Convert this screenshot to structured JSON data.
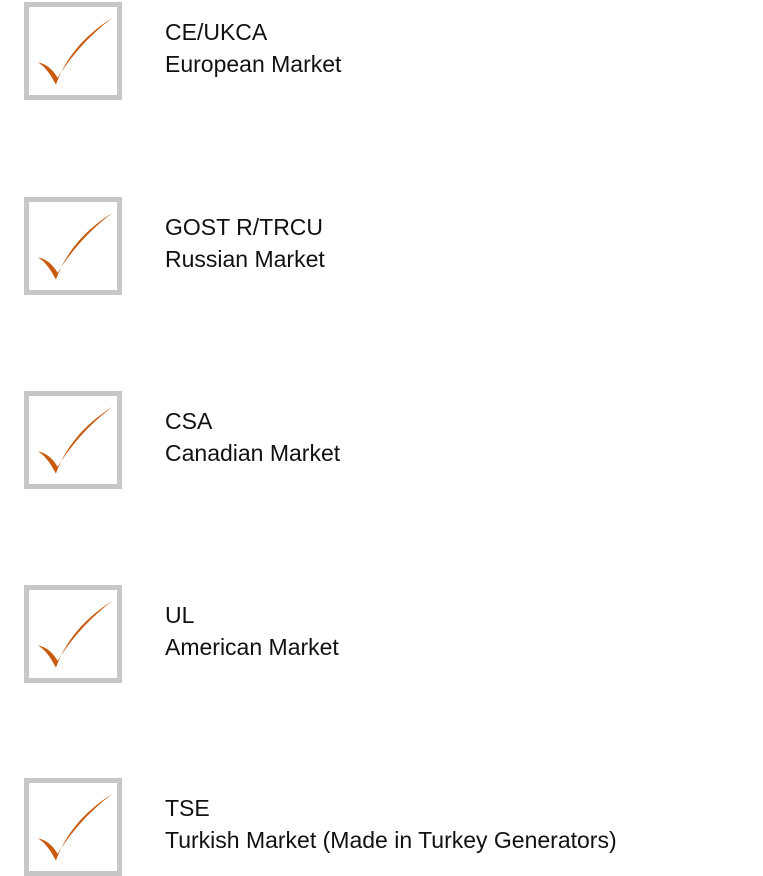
{
  "colors": {
    "check": "#c85a0e",
    "check_highlight": "#e07a2a",
    "box_border": "#c7c7c7",
    "text": "#111111"
  },
  "items": [
    {
      "title": "CE/UKCA",
      "subtitle": "European Market",
      "icon": "checkmark-icon",
      "checked": true
    },
    {
      "title": "GOST R/TRCU",
      "subtitle": "Russian Market",
      "icon": "checkmark-icon",
      "checked": true
    },
    {
      "title": "CSA",
      "subtitle": "Canadian Market",
      "icon": "checkmark-icon",
      "checked": true
    },
    {
      "title": "UL",
      "subtitle": "American Market",
      "icon": "checkmark-icon",
      "checked": true
    },
    {
      "title": "TSE",
      "subtitle": "Turkish Market (Made in Turkey Generators)",
      "icon": "checkmark-icon",
      "checked": true
    }
  ]
}
